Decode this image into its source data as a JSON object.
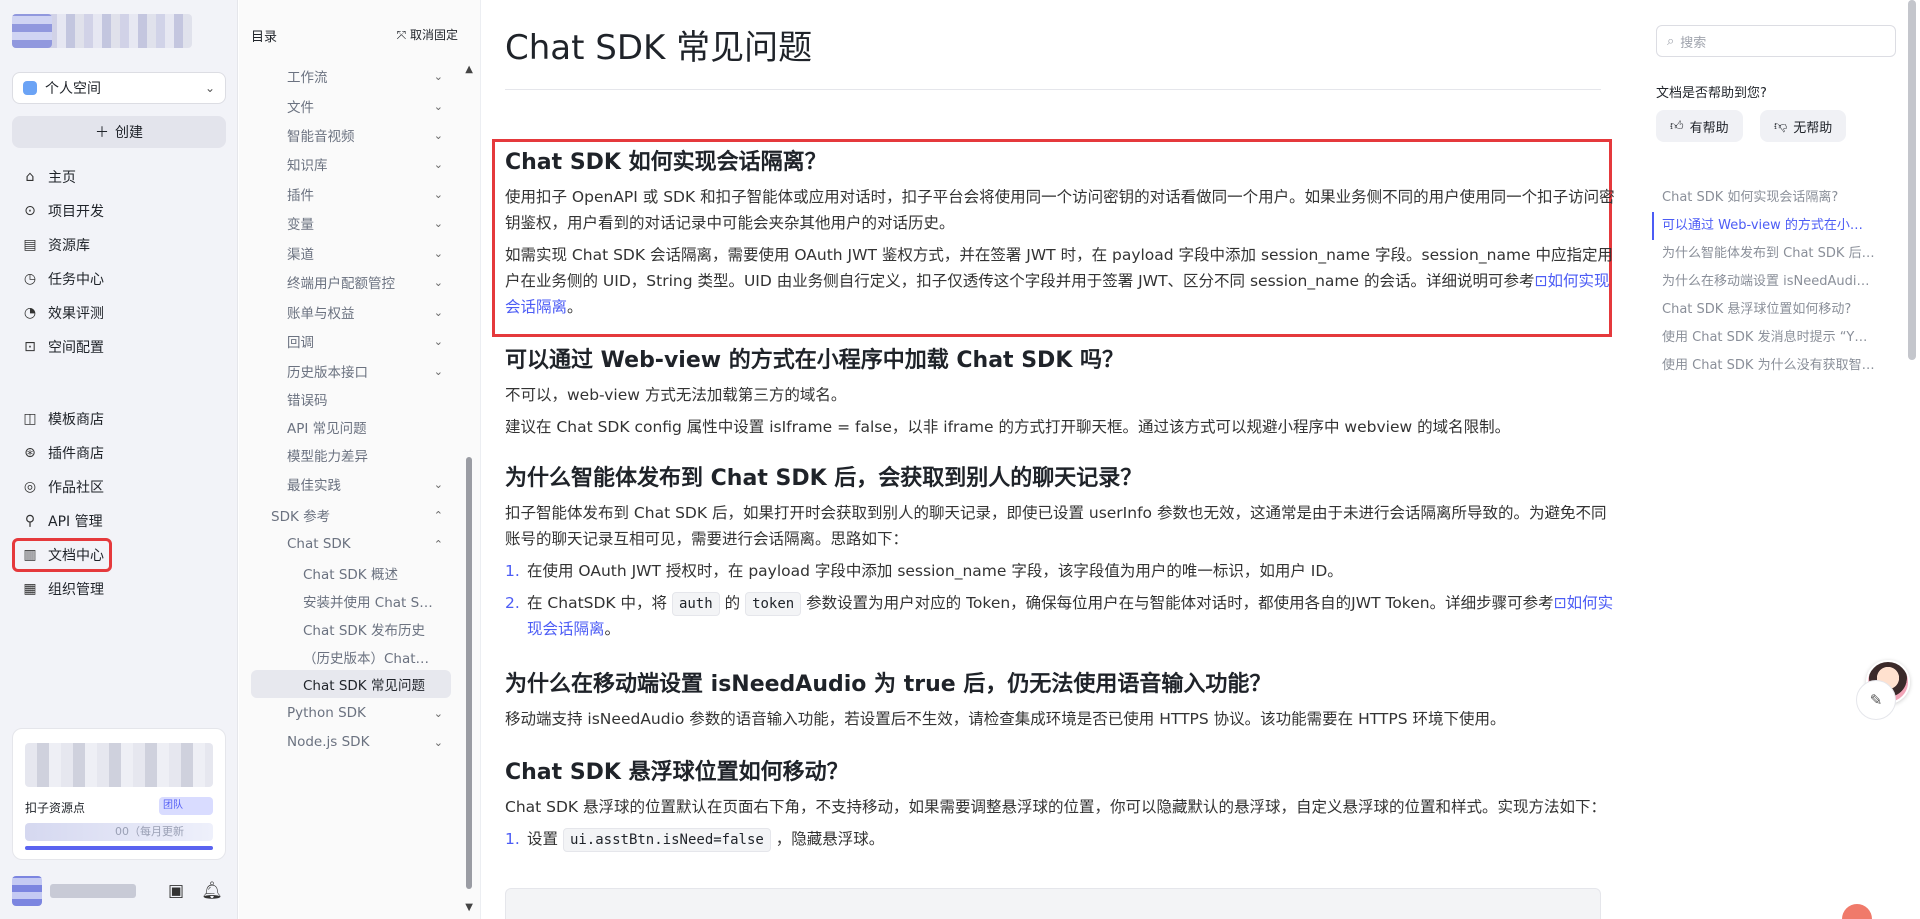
{
  "app": {
    "space": {
      "label": "个人空间"
    },
    "create_label": "创建",
    "nav_primary": [
      {
        "label": "主页",
        "icon": "home-icon",
        "glyph": "⌂"
      },
      {
        "label": "项目开发",
        "icon": "project-icon",
        "glyph": "⊙"
      },
      {
        "label": "资源库",
        "icon": "library-icon",
        "glyph": "▤"
      },
      {
        "label": "任务中心",
        "icon": "task-icon",
        "glyph": "◷"
      },
      {
        "label": "效果评测",
        "icon": "gauge-icon",
        "glyph": "◔"
      },
      {
        "label": "空间配置",
        "icon": "config-icon",
        "glyph": "⊡"
      }
    ],
    "nav_secondary": [
      {
        "label": "模板商店",
        "icon": "template-icon",
        "glyph": "◫"
      },
      {
        "label": "插件商店",
        "icon": "plugin-icon",
        "glyph": "⊛"
      },
      {
        "label": "作品社区",
        "icon": "community-icon",
        "glyph": "◎"
      },
      {
        "label": "API 管理",
        "icon": "api-icon",
        "glyph": "⚲"
      },
      {
        "label": "文档中心",
        "icon": "doc-icon",
        "glyph": "▥"
      },
      {
        "label": "组织管理",
        "icon": "org-icon",
        "glyph": "▦"
      }
    ],
    "resource": {
      "title": "扣子资源点",
      "badge": "团队",
      "line": "00（每月更新"
    }
  },
  "toc": {
    "heading": "目录",
    "unpin_label": "取消固定",
    "items": [
      {
        "label": "工作流",
        "chevron": "⌄",
        "indent": 1
      },
      {
        "label": "文件",
        "chevron": "⌄",
        "indent": 1
      },
      {
        "label": "智能音视频",
        "chevron": "⌄",
        "indent": 1
      },
      {
        "label": "知识库",
        "chevron": "⌄",
        "indent": 1
      },
      {
        "label": "插件",
        "chevron": "⌄",
        "indent": 1
      },
      {
        "label": "变量",
        "chevron": "⌄",
        "indent": 1
      },
      {
        "label": "渠道",
        "chevron": "⌄",
        "indent": 1
      },
      {
        "label": "终端用户配额管控",
        "chevron": "⌄",
        "indent": 1
      },
      {
        "label": "账单与权益",
        "chevron": "⌄",
        "indent": 1
      },
      {
        "label": "回调",
        "chevron": "⌄",
        "indent": 1
      },
      {
        "label": "历史版本接口",
        "chevron": "⌄",
        "indent": 1
      },
      {
        "label": "错误码",
        "chevron": "",
        "indent": 1
      },
      {
        "label": "API 常见问题",
        "chevron": "",
        "indent": 1
      },
      {
        "label": "模型能力差异",
        "chevron": "",
        "indent": 1
      },
      {
        "label": "最佳实践",
        "chevron": "⌄",
        "indent": 1
      },
      {
        "label": "SDK 参考",
        "chevron": "⌃",
        "indent": 0
      },
      {
        "label": "Chat SDK",
        "chevron": "⌃",
        "indent": 1
      },
      {
        "label": "Chat SDK 概述",
        "chevron": "",
        "indent": 2
      },
      {
        "label": "安装并使用 Chat S…",
        "chevron": "",
        "indent": 2
      },
      {
        "label": "Chat SDK 发布历史",
        "chevron": "",
        "indent": 2
      },
      {
        "label": "（历史版本）Chat…",
        "chevron": "",
        "indent": 2
      },
      {
        "label": "Chat SDK 常见问题",
        "chevron": "",
        "indent": 2,
        "active": true
      },
      {
        "label": "Python SDK",
        "chevron": "⌄",
        "indent": 1
      },
      {
        "label": "Node.js SDK",
        "chevron": "⌄",
        "indent": 1
      }
    ]
  },
  "doc": {
    "title": "Chat SDK 常见问题",
    "s1": {
      "heading": "Chat SDK 如何实现会话隔离？",
      "p1": "使用扣子 OpenAPI 或 SDK 和扣子智能体或应用对话时，扣子平台会将使用同一个访问密钥的对话看做同一个用户。如果业务侧不同的用户使用同一个扣子访问密钥鉴权，用户看到的对话记录中可能会夹杂其他用户的对话历史。",
      "p2": "如需实现 Chat SDK 会话隔离，需要使用 OAuth JWT 鉴权方式，并在签署 JWT 时，在 payload 字段中添加 session_name 字段。session_name 中应指定用户在业务侧的 UID，String 类型。UID 由业务侧自行定义，扣子仅透传这个字段并用于签署 JWT、区分不同 session_name 的会话。详细说明可参考",
      "p2_link": "⊡如何实现会话隔离",
      "p2_end": "。"
    },
    "s2": {
      "heading": "可以通过 Web-view 的方式在小程序中加载 Chat SDK 吗？",
      "p1": "不可以，web-view 方式无法加载第三方的域名。",
      "p2": "建议在 Chat SDK config 属性中设置 isIframe = false，以非 iframe 的方式打开聊天框。通过该方式可以规避小程序中 webview 的域名限制。"
    },
    "s3": {
      "heading": "为什么智能体发布到 Chat SDK 后，会获取到别人的聊天记录？",
      "p1": "扣子智能体发布到 Chat SDK 后，如果打开时会获取到别人的聊天记录，即使已设置 userInfo 参数也无效，这通常是由于未进行会话隔离所导致的。为避免不同账号的聊天记录互相可见，需要进行会话隔离。思路如下：",
      "li1_num": "1.",
      "li1": "在使用 OAuth JWT 授权时，在 payload 字段中添加 session_name 字段，该字段值为用户的唯一标识，如用户 ID。",
      "li2_num": "2.",
      "li2_a": "在 ChatSDK 中，将",
      "li2_code1": "auth",
      "li2_b": "的",
      "li2_code2": "token",
      "li2_c": "参数设置为用户对应的 Token，确保每位用户在与智能体对话时，都使用各自的JWT Token。详细步骤可参考",
      "li2_link": "⊡如何实现会话隔离",
      "li2_end": "。"
    },
    "s4": {
      "heading": "为什么在移动端设置 isNeedAudio 为 true 后，仍无法使用语音输入功能？",
      "p1": "移动端支持 isNeedAudio 参数的语音输入功能，若设置后不生效，请检查集成环境是否已使用 HTTPS 协议。该功能需要在 HTTPS 环境下使用。"
    },
    "s5": {
      "heading": "Chat SDK 悬浮球位置如何移动？",
      "p1": "Chat SDK 悬浮球的位置默认在页面右下角，不支持移动，如果需要调整悬浮球的位置，你可以隐藏默认的悬浮球，自定义悬浮球的位置和样式。实现方法如下：",
      "li1_num": "1.",
      "li1_a": "设置",
      "li1_code": "ui.asstBtn.isNeed=false",
      "li1_b": "，隐藏悬浮球。"
    }
  },
  "right": {
    "search_placeholder": "搜索",
    "feedback_question": "文档是否帮助到您?",
    "helpful_label": "有帮助",
    "unhelpful_label": "无帮助",
    "anchors": [
      {
        "label": "Chat SDK 如何实现会话隔离?",
        "active": false
      },
      {
        "label": "可以通过 Web-view 的方式在小…",
        "active": true
      },
      {
        "label": "为什么智能体发布到 Chat SDK 后…",
        "active": false
      },
      {
        "label": "为什么在移动端设置 isNeedAudi…",
        "active": false
      },
      {
        "label": "Chat SDK 悬浮球位置如何移动?",
        "active": false
      },
      {
        "label": "使用 Chat SDK 发消息时提示 “Y…",
        "active": false
      },
      {
        "label": "使用 Chat SDK 为什么没有获取智…",
        "active": false
      }
    ]
  }
}
